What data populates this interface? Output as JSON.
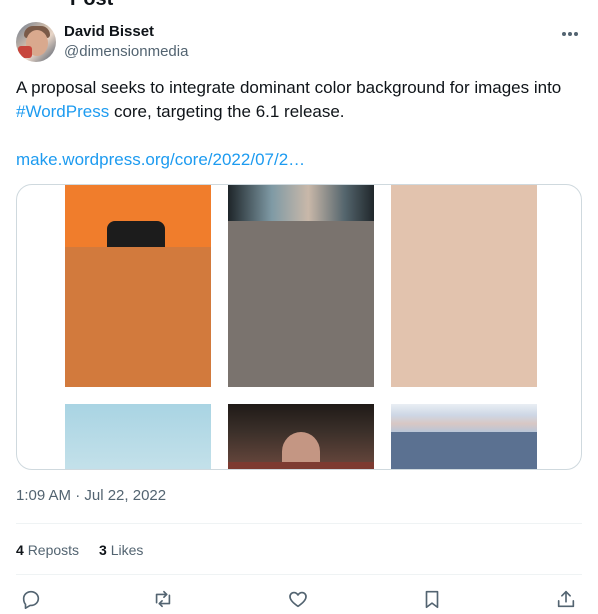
{
  "page_header": {
    "title_fragment": "Post"
  },
  "author": {
    "display_name": "David Bisset",
    "handle": "@dimensionmedia"
  },
  "post": {
    "text_part1": "A proposal seeks to integrate dominant color background for images into ",
    "hashtag": "#WordPress",
    "text_part2": " core, targeting the 6.1 release.",
    "link": "make.wordpress.org/core/2022/07/2…"
  },
  "timestamp": "1:09 AM · Jul 22, 2022",
  "stats": {
    "reposts_count": "4",
    "reposts_label": "Reposts",
    "likes_count": "3",
    "likes_label": "Likes"
  },
  "colors": {
    "link": "#1d9bf0",
    "text_secondary": "#536471",
    "tile_orange": "#d27a3d",
    "tile_gray": "#7a736e",
    "tile_beige": "#e2c3ae",
    "tile_sky": "#b3d7e3",
    "tile_slate": "#5b7191"
  },
  "icons": [
    "more-icon",
    "reply-icon",
    "repost-icon",
    "like-icon",
    "bookmark-icon",
    "share-icon"
  ]
}
